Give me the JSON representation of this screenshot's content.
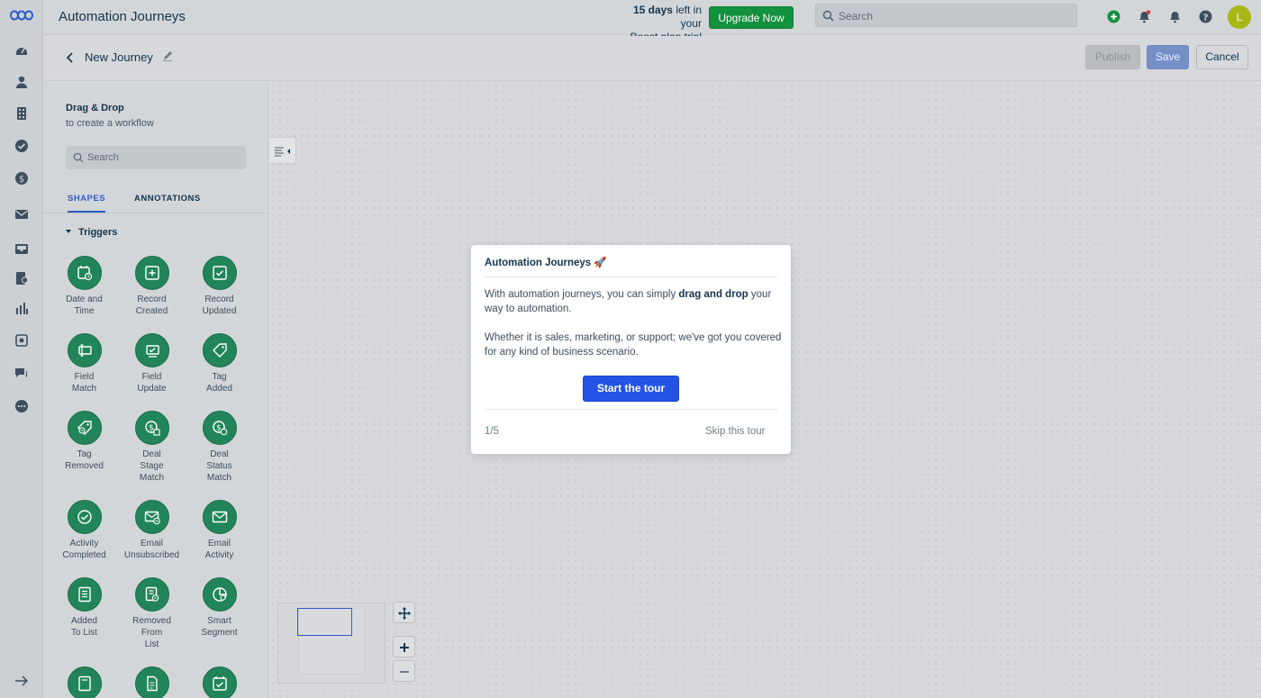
{
  "header": {
    "title": "Automation Journeys",
    "trial_days": "15 days",
    "trial_line1_rest": " left in your",
    "trial_line2": "Boost plan trial",
    "upgrade_label": "Upgrade Now",
    "search_placeholder": "Search",
    "avatar_initial": "L"
  },
  "subheader": {
    "journey_name": "New Journey",
    "publish_label": "Publish",
    "save_label": "Save",
    "cancel_label": "Cancel"
  },
  "panel": {
    "title": "Drag & Drop",
    "subtitle": "to create a workflow",
    "search_placeholder": "Search",
    "tabs": [
      "SHAPES",
      "ANNOTATIONS"
    ],
    "section": "Triggers",
    "shapes": [
      {
        "label": "Date and\nTime",
        "icon": "calendar-clock-icon"
      },
      {
        "label": "Record\nCreated",
        "icon": "record-plus-icon"
      },
      {
        "label": "Record\nUpdated",
        "icon": "record-check-icon"
      },
      {
        "label": "Field\nMatch",
        "icon": "field-match-icon"
      },
      {
        "label": "Field\nUpdate",
        "icon": "field-update-icon"
      },
      {
        "label": "Tag\nAdded",
        "icon": "tag-icon"
      },
      {
        "label": "Tag\nRemoved",
        "icon": "tag-remove-icon"
      },
      {
        "label": "Deal\nStage\nMatch",
        "icon": "deal-stage-icon"
      },
      {
        "label": "Deal\nStatus\nMatch",
        "icon": "deal-status-icon"
      },
      {
        "label": "Activity\nCompleted",
        "icon": "check-circle-icon"
      },
      {
        "label": "Email\nUnsubscribed",
        "icon": "email-minus-icon"
      },
      {
        "label": "Email\nActivity",
        "icon": "email-icon"
      },
      {
        "label": "Added\nTo List",
        "icon": "list-icon"
      },
      {
        "label": "Removed\nFrom\nList",
        "icon": "list-remove-icon"
      },
      {
        "label": "Smart\nSegment",
        "icon": "segment-icon"
      },
      {
        "label": "",
        "icon": "document-icon"
      },
      {
        "label": "",
        "icon": "invoice-icon"
      },
      {
        "label": "",
        "icon": "calendar-check-icon"
      }
    ]
  },
  "modal": {
    "title": "Automation Journeys 🚀",
    "p1_before": "With automation journeys, you can simply ",
    "p1_bold": "drag and drop",
    "p1_after": " your way to automation.",
    "p2": "Whether it is sales, marketing, or support; we've got you covered for any kind of business scenario.",
    "start_label": "Start the tour",
    "step": "1/5",
    "skip_label": "Skip this tour"
  },
  "colors": {
    "shape_green": "#22855a",
    "primary_blue": "#2453e6",
    "upgrade_green": "#13913f"
  }
}
